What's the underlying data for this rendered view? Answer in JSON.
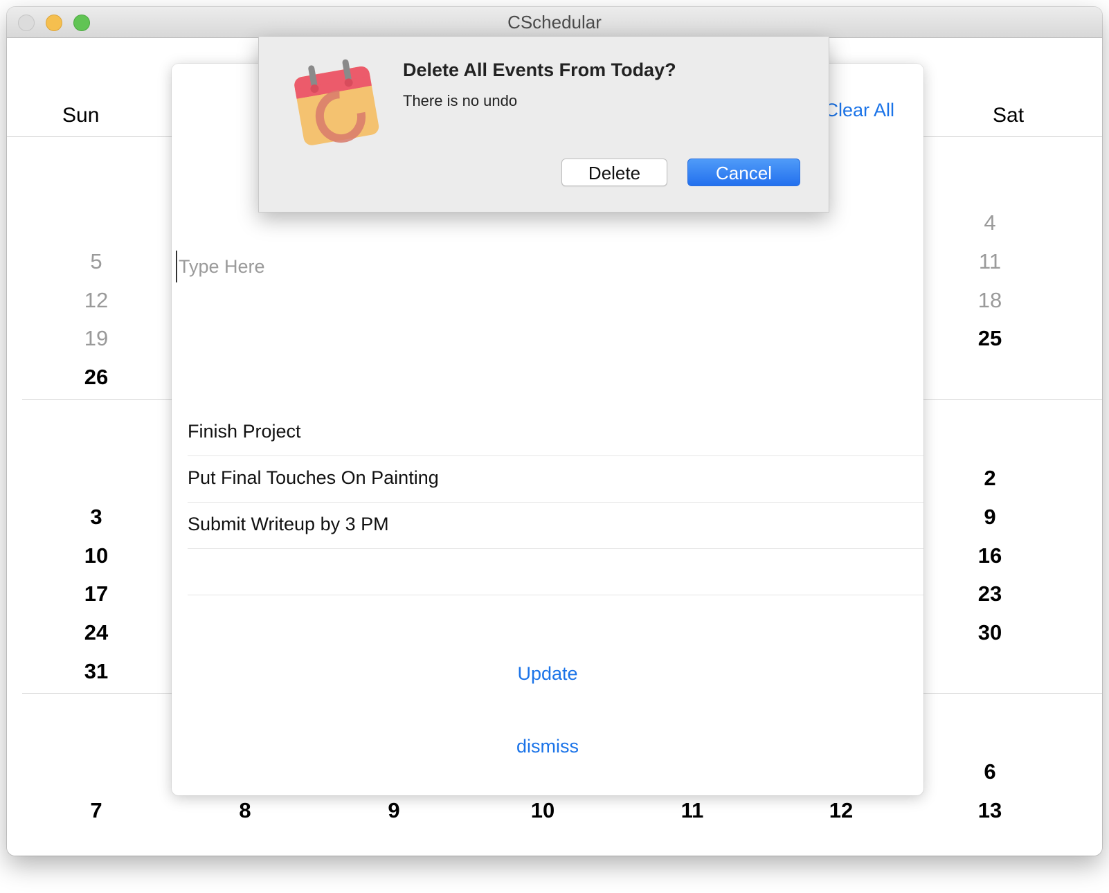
{
  "window": {
    "title": "CSchedular"
  },
  "calendar": {
    "day_headers": {
      "sun": "Sun",
      "sat": "Sat"
    },
    "sun_numbers": [
      "5",
      "12",
      "19",
      "26",
      "3",
      "10",
      "17",
      "24",
      "31",
      "7"
    ],
    "sat_numbers": [
      "4",
      "11",
      "18",
      "25",
      "2",
      "9",
      "16",
      "23",
      "30",
      "6",
      "13"
    ],
    "bottom_row": [
      "8",
      "9",
      "10",
      "11",
      "12"
    ]
  },
  "sheet": {
    "clear_all_label": "Clear All",
    "input_placeholder": "Type Here",
    "input_value": "",
    "events": [
      "Finish Project",
      "Put Final Touches On Painting",
      "Submit Writeup by 3 PM",
      ""
    ],
    "update_label": "Update",
    "dismiss_label": "dismiss"
  },
  "alert": {
    "icon": "calendar-app-icon",
    "title": "Delete All Events From Today?",
    "message": "There is no undo",
    "delete_label": "Delete",
    "cancel_label": "Cancel"
  },
  "colors": {
    "accent": "#1a73e8",
    "default_button": "#2370ee",
    "muted_text": "#9a9a9a"
  }
}
